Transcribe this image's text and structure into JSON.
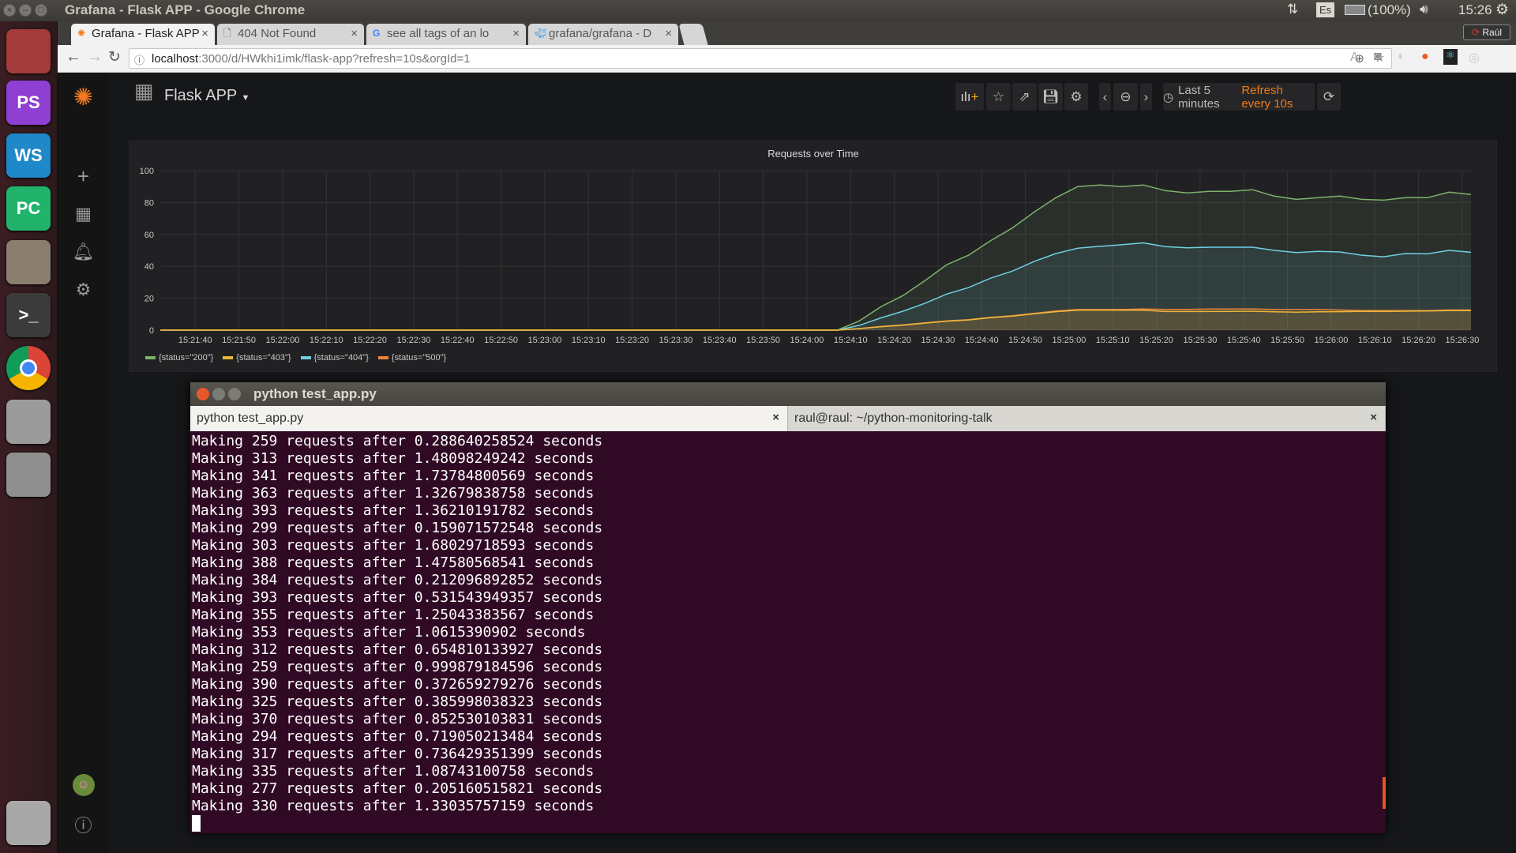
{
  "os": {
    "window_title": "Grafana - Flask APP - Google Chrome",
    "keyboard_layout": "Es",
    "battery": "(100%)",
    "clock": "15:26",
    "user": "Raúl",
    "launcher": [
      {
        "name": "ubuntu-dash",
        "label": "",
        "color": "#a33b3b"
      },
      {
        "name": "phpstorm",
        "label": "PS",
        "color": "#8f3fd1"
      },
      {
        "name": "webstorm",
        "label": "WS",
        "color": "#1e88c8"
      },
      {
        "name": "pycharm",
        "label": "PC",
        "color": "#21b36b"
      },
      {
        "name": "files",
        "label": "",
        "color": "#8a7e6f"
      },
      {
        "name": "terminal",
        "label": ">_",
        "color": "#3b3b3b"
      },
      {
        "name": "chrome",
        "label": "",
        "color": "#e9e9e9"
      },
      {
        "name": "camera",
        "label": "",
        "color": "#9b9b9b"
      },
      {
        "name": "system-settings",
        "label": "",
        "color": "#8f8f8f"
      },
      {
        "name": "trash",
        "label": "",
        "color": "#a8a8a8"
      }
    ]
  },
  "browser": {
    "tabs": [
      {
        "title": "Grafana - Flask APP",
        "active": true
      },
      {
        "title": "404 Not Found",
        "active": false
      },
      {
        "title": "see all tags of an lo",
        "active": false
      },
      {
        "title": "grafana/grafana - D",
        "active": false
      }
    ],
    "url_host": "localhost",
    "url_rest": ":3000/d/HWkhi1imk/flask-app?refresh=10s&orgId=1"
  },
  "grafana": {
    "dashboard_title": "Flask APP",
    "time_range": "Last 5 minutes",
    "refresh": "Refresh every 10s",
    "panel_title": "Requests over Time"
  },
  "chart_data": {
    "type": "area",
    "title": "Requests over Time",
    "ylim": [
      0,
      100
    ],
    "yticks": [
      "0",
      "20",
      "40",
      "60",
      "80",
      "100"
    ],
    "xlim": [
      "15:21:32",
      "15:26:32"
    ],
    "xticks": [
      "15:21:40",
      "15:21:50",
      "15:22:00",
      "15:22:10",
      "15:22:20",
      "15:22:30",
      "15:22:40",
      "15:22:50",
      "15:23:00",
      "15:23:10",
      "15:23:20",
      "15:23:30",
      "15:23:40",
      "15:23:50",
      "15:24:00",
      "15:24:10",
      "15:24:20",
      "15:24:30",
      "15:24:40",
      "15:24:50",
      "15:25:00",
      "15:25:10",
      "15:25:20",
      "15:25:30",
      "15:25:40",
      "15:25:50",
      "15:26:00",
      "15:26:10",
      "15:26:20",
      "15:26:30"
    ],
    "grid": true,
    "legend": "bottom-left",
    "x": [
      "15:21:32",
      "15:24:07",
      "15:24:12",
      "15:24:17",
      "15:24:22",
      "15:24:27",
      "15:24:32",
      "15:24:37",
      "15:24:42",
      "15:24:47",
      "15:24:52",
      "15:24:57",
      "15:25:02",
      "15:25:07",
      "15:25:12",
      "15:25:17",
      "15:25:22",
      "15:25:27",
      "15:25:32",
      "15:25:37",
      "15:25:42",
      "15:25:47",
      "15:25:52",
      "15:25:57",
      "15:26:02",
      "15:26:07",
      "15:26:12",
      "15:26:17",
      "15:26:22",
      "15:26:27",
      "15:26:32"
    ],
    "series": [
      {
        "name": "{status=\"200\"}",
        "color": "#7eb26d",
        "values": [
          0,
          0,
          5.8,
          14.8,
          21.7,
          31,
          41,
          47,
          56,
          64,
          74,
          83,
          90,
          91,
          90,
          91,
          87.5,
          86,
          87,
          87,
          88,
          84,
          82,
          83,
          84,
          82,
          81.5,
          83,
          83,
          86.5,
          85
        ]
      },
      {
        "name": "{status=\"403\"}",
        "color": "#eab839",
        "values": [
          0,
          0,
          1,
          2.2,
          3.1,
          4.4,
          5.6,
          6.4,
          7.8,
          8.8,
          10.2,
          11.6,
          12.5,
          12.5,
          12.5,
          12.5,
          11.7,
          11.7,
          11.7,
          11.8,
          11.9,
          11.5,
          11.3,
          11.5,
          11.6,
          11.8,
          11.7,
          11.9,
          12,
          12.3,
          12.3
        ]
      },
      {
        "name": "{status=\"404\"}",
        "color": "#6ed0e0",
        "values": [
          0,
          0,
          3,
          7.7,
          11.9,
          16.8,
          22.6,
          26.7,
          32.5,
          37,
          43,
          48,
          51.4,
          52.5,
          53.5,
          54.7,
          52.4,
          51.6,
          52,
          52,
          52,
          50,
          48.6,
          49.4,
          49,
          47,
          46,
          48,
          47.8,
          50,
          48.8
        ]
      },
      {
        "name": "{status=\"500\"}",
        "color": "#ef843c",
        "values": [
          0,
          0,
          1,
          2.3,
          3.3,
          4.6,
          5.8,
          6.6,
          8,
          9,
          10.5,
          12,
          12.9,
          12.9,
          12.9,
          13.2,
          13,
          13,
          13.2,
          13.2,
          13.3,
          12.9,
          12.9,
          12.9,
          12.6,
          12.3,
          12.3,
          12.3,
          12.3,
          12.6,
          12.6
        ]
      }
    ]
  },
  "terminal": {
    "window_title": "python test_app.py",
    "tabs": [
      {
        "title": "python test_app.py",
        "active": true
      },
      {
        "title": "raul@raul: ~/python-monitoring-talk",
        "active": false
      }
    ],
    "lines": [
      "Making 259 requests after 0.288640258524 seconds",
      "Making 313 requests after 1.48098249242 seconds",
      "Making 341 requests after 1.73784800569 seconds",
      "Making 363 requests after 1.32679838758 seconds",
      "Making 393 requests after 1.36210191782 seconds",
      "Making 299 requests after 0.159071572548 seconds",
      "Making 303 requests after 1.68029718593 seconds",
      "Making 388 requests after 1.47580568541 seconds",
      "Making 384 requests after 0.212096892852 seconds",
      "Making 393 requests after 0.531543949357 seconds",
      "Making 355 requests after 1.25043383567 seconds",
      "Making 353 requests after 1.0615390902 seconds",
      "Making 312 requests after 0.654810133927 seconds",
      "Making 259 requests after 0.999879184596 seconds",
      "Making 390 requests after 0.372659279276 seconds",
      "Making 325 requests after 0.385998038323 seconds",
      "Making 370 requests after 0.852530103831 seconds",
      "Making 294 requests after 0.719050213484 seconds",
      "Making 317 requests after 0.736429351399 seconds",
      "Making 335 requests after 1.08743100758 seconds",
      "Making 277 requests after 0.205160515821 seconds",
      "Making 330 requests after 1.33035757159 seconds"
    ]
  }
}
